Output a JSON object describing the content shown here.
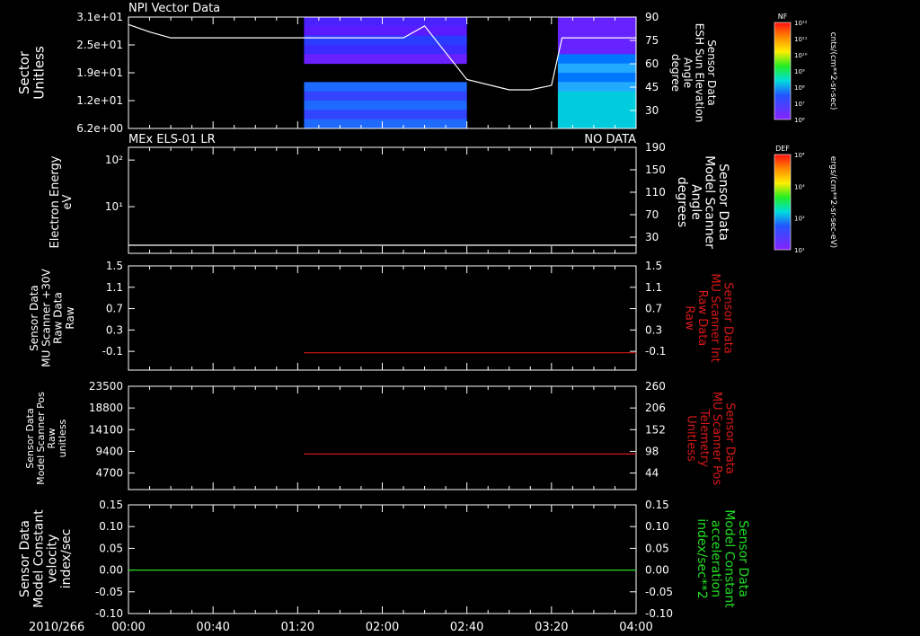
{
  "date_label": "2010/266",
  "time_ticks": [
    "00:00",
    "00:40",
    "01:20",
    "02:00",
    "02:40",
    "03:20",
    "04:00"
  ],
  "colors": {
    "white": "#ffffff",
    "red": "#d81818",
    "green": "#22dd22"
  },
  "chart_data": [
    {
      "id": "npi",
      "type": "heatmap",
      "title": "NPI Vector Data",
      "ylabel": "Sector\nUnitless",
      "y_ticks": [
        "3.1e+01",
        "2.5e+01",
        "1.9e+01",
        "1.2e+01",
        "6.2e+00"
      ],
      "y2label": "Sensor Data\nESH Sun Elevation\nAngle\ndegree",
      "y2_ticks": [
        "90",
        "75",
        "60",
        "45",
        "30"
      ],
      "colorbar_label": "NF",
      "colorbar_units": "cnts/(cm**2-sr-sec)",
      "colorbar_ticks": [
        "10¹²",
        "10¹¹",
        "10¹⁰",
        "10⁹",
        "10⁸",
        "10⁷",
        "10⁶"
      ],
      "data_intervals": [
        [
          "01:23",
          "02:40"
        ],
        [
          "03:23",
          "04:00"
        ]
      ],
      "series": [
        {
          "x": [
            "00:00",
            "00:10",
            "00:20",
            "00:40",
            "01:20",
            "02:00",
            "02:10",
            "02:20",
            "02:40",
            "03:00",
            "03:10",
            "03:20",
            "03:25",
            "04:00"
          ],
          "y": [
            85,
            80,
            76,
            76,
            76,
            76,
            76,
            84,
            48,
            41,
            41,
            44,
            76,
            76
          ]
        }
      ]
    },
    {
      "id": "els",
      "type": "line",
      "title": "MEx ELS-01 LR",
      "status": "NO DATA",
      "ylabel": "Electron Energy\neV",
      "y_ticks": [
        "10²",
        "10¹"
      ],
      "y2label": "Sensor Data\nModel Scanner\nAngle\ndegrees",
      "y2_ticks": [
        "190",
        "150",
        "110",
        "70",
        "30"
      ],
      "colorbar_label": "DEF",
      "colorbar_units": "ergs/(cm**2-sr-sec-eV)",
      "colorbar_ticks": [
        "10⁴",
        "10³",
        "10²",
        "10¹"
      ],
      "series": [
        {
          "x": [
            "00:00",
            "04:00"
          ],
          "y": [
            10,
            10
          ]
        }
      ]
    },
    {
      "id": "mu30",
      "type": "line",
      "ylabel": "Sensor Data\nMU Scanner +30V\nRaw Data\nRaw",
      "y_ticks": [
        "1.5",
        "1.1",
        "0.7",
        "0.3",
        "-0.1"
      ],
      "y2label": "Sensor Data\nMU Scanner Int\nRaw Data\nRaw",
      "y2_ticks": [
        "1.5",
        "1.1",
        "0.7",
        "0.3",
        "-0.1"
      ],
      "ylim": [
        -0.3,
        1.5
      ],
      "series": [
        {
          "x": [
            "01:23",
            "04:00"
          ],
          "y": [
            0,
            0
          ]
        }
      ]
    },
    {
      "id": "mupos",
      "type": "line",
      "ylabel": "Sensor Data\nModel Scanner Pos\nRaw\nunitless",
      "y_ticks": [
        "23500",
        "18800",
        "14100",
        "9400",
        "4700"
      ],
      "y2label": "Sensor Data\nMU Scanner Pos\nTelemetry\nUnitless",
      "y2_ticks": [
        "260",
        "206",
        "152",
        "98",
        "44"
      ],
      "ylim": [
        0,
        23500
      ],
      "series": [
        {
          "x": [
            "01:23",
            "04:00"
          ],
          "y": [
            8100,
            8100
          ]
        }
      ]
    },
    {
      "id": "model",
      "type": "line",
      "ylabel": "Sensor Data\nModel Constant\nvelocity\nindex/sec",
      "y_ticks": [
        "0.15",
        "0.10",
        "0.05",
        "0.00",
        "-0.05",
        "-0.10"
      ],
      "y2label": "Sensor Data\nModel Constant\nacceleration\nindex/sec**2",
      "y2_ticks": [
        "0.15",
        "0.10",
        "0.05",
        "0.00",
        "-0.05",
        "-0.10"
      ],
      "ylim": [
        -0.1,
        0.15
      ],
      "series": [
        {
          "x": [
            "00:00",
            "04:00"
          ],
          "y": [
            0,
            0
          ]
        }
      ]
    }
  ]
}
